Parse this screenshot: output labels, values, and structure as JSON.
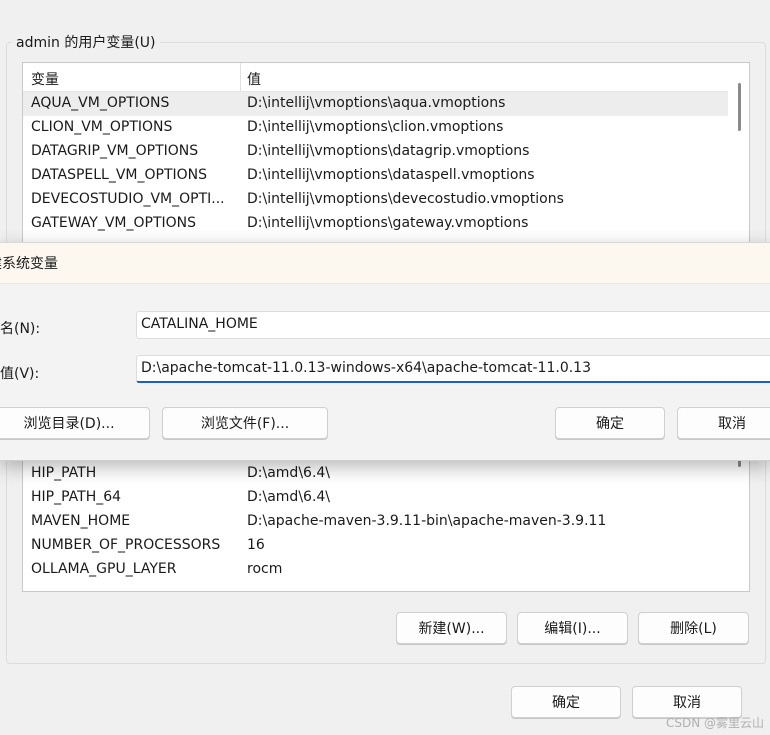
{
  "user_vars": {
    "title": "admin 的用户变量(U)",
    "col_name": "变量",
    "col_value": "值",
    "rows_top": [
      {
        "name": "AQUA_VM_OPTIONS",
        "value": "D:\\intellij\\vmoptions\\aqua.vmoptions"
      },
      {
        "name": "CLION_VM_OPTIONS",
        "value": "D:\\intellij\\vmoptions\\clion.vmoptions"
      },
      {
        "name": "DATAGRIP_VM_OPTIONS",
        "value": "D:\\intellij\\vmoptions\\datagrip.vmoptions"
      },
      {
        "name": "DATASPELL_VM_OPTIONS",
        "value": "D:\\intellij\\vmoptions\\dataspell.vmoptions"
      },
      {
        "name": "DEVECOSTUDIO_VM_OPTI...",
        "value": "D:\\intellij\\vmoptions\\devecostudio.vmoptions"
      },
      {
        "name": "GATEWAY_VM_OPTIONS",
        "value": "D:\\intellij\\vmoptions\\gateway.vmoptions"
      }
    ],
    "rows_bottom": [
      {
        "name": "HIP_PATH",
        "value": "D:\\amd\\6.4\\"
      },
      {
        "name": "HIP_PATH_64",
        "value": "D:\\amd\\6.4\\"
      },
      {
        "name": "MAVEN_HOME",
        "value": "D:\\apache-maven-3.9.11-bin\\apache-maven-3.9.11"
      },
      {
        "name": "NUMBER_OF_PROCESSORS",
        "value": "16"
      },
      {
        "name": "OLLAMA_GPU_LAYER",
        "value": "rocm"
      }
    ],
    "buttons": {
      "new": "新建(W)...",
      "edit": "编辑(I)...",
      "delete": "删除(L)"
    }
  },
  "dialog": {
    "title": "建系统变量",
    "name_label": "量名(N):",
    "name_value": "CATALINA_HOME",
    "value_label": "量值(V):",
    "value_value": "D:\\apache-tomcat-11.0.13-windows-x64\\apache-tomcat-11.0.13",
    "browse_dir": "浏览目录(D)...",
    "browse_file": "浏览文件(F)...",
    "ok": "确定",
    "cancel": "取消"
  },
  "footer": {
    "ok": "确定",
    "cancel": "取消"
  },
  "watermark": "CSDN @雾里云山"
}
